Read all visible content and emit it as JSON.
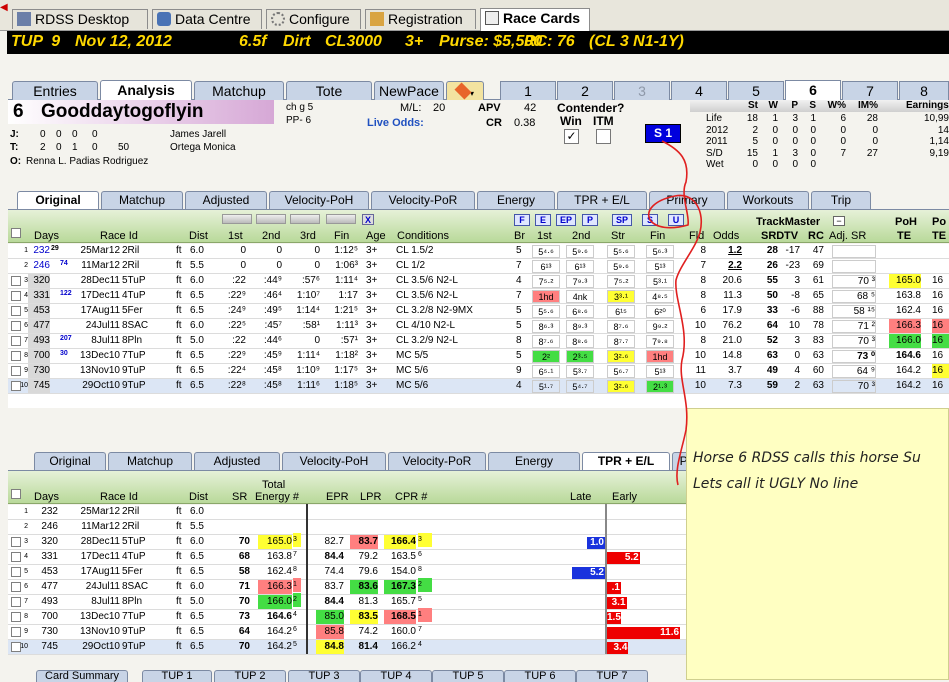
{
  "top_tabs": [
    "RDSS Desktop",
    "Data Centre",
    "Configure",
    "Registration",
    "Race Cards"
  ],
  "header": {
    "track": "TUP",
    "race": "9",
    "date": "Nov 12, 2012",
    "dist": "6.5f",
    "surface": "Dirt",
    "class": "CL3000",
    "age": "3+",
    "purse": "Purse: $5,500",
    "rc": "RC: 76",
    "cond": "(CL 3 N1-1Y)"
  },
  "sub_tabs": [
    "Entries",
    "Analysis",
    "Matchup",
    "Tote",
    "NewPace"
  ],
  "num_tabs": [
    "1",
    "2",
    "3",
    "4",
    "5",
    "6",
    "7",
    "8"
  ],
  "horse": {
    "num": "6",
    "name": "Gooddaytogoflyin",
    "sex": "ch g 5",
    "pp": "PP- 6",
    "ml_label": "M/L:",
    "ml": "20",
    "live_odds": "Live Odds:",
    "apv_label": "APV",
    "apv": "42",
    "cr_label": "CR",
    "cr": "0.38",
    "j_label": "J:",
    "j_stats": [
      "0",
      "0",
      "0",
      "0"
    ],
    "jockey": "James Jarell",
    "t_label": "T:",
    "t_stats": [
      "2",
      "0",
      "1",
      "0",
      "50"
    ],
    "trainer": "Ortega Monica",
    "o_label": "O:",
    "owner": "Renna L. Padias Rodriguez"
  },
  "contender": {
    "title": "Contender?",
    "win": "Win",
    "itm": "ITM",
    "check": "✓",
    "s1": "S 1"
  },
  "record": {
    "headers": [
      "St",
      "W",
      "P",
      "S",
      "W%",
      "IM%",
      "Earnings"
    ],
    "rows": [
      [
        "Life",
        "18",
        "1",
        "3",
        "1",
        "6",
        "28",
        "10,99"
      ],
      [
        "2012",
        "2",
        "0",
        "0",
        "0",
        "0",
        "0",
        "14"
      ],
      [
        "2011",
        "5",
        "0",
        "0",
        "0",
        "0",
        "0",
        "1,14"
      ],
      [
        "S/D",
        "15",
        "1",
        "3",
        "0",
        "7",
        "27",
        "9,19"
      ],
      [
        "Wet",
        "0",
        "0",
        "0",
        "0",
        "",
        "",
        ""
      ]
    ]
  },
  "row_tabs_top": [
    "Original",
    "Matchup",
    "Adjusted",
    "Velocity-PoH",
    "Velocity-PoR",
    "Energy",
    "TPR + E/L",
    "Primary",
    "Workouts",
    "Trip"
  ],
  "upper_grid": {
    "headers": {
      "days": "Days",
      "race_id": "Race Id",
      "dist": "Dist",
      "c1st": "1st",
      "c2nd": "2nd",
      "c3rd": "3rd",
      "fin": "Fin",
      "age": "Age",
      "conditions": "Conditions",
      "br": "Br",
      "b1st": "1st",
      "b2nd": "2nd",
      "str": "Str",
      "bfin": "Fin",
      "fld": "Fld",
      "odds": "Odds",
      "tm": "TrackMaster",
      "srd": "SRD",
      "tv": "TV",
      "rc": "RC",
      "adj": "Adj. SR",
      "poh": "PoH",
      "te": "TE",
      "po": "Po",
      "te2": "TE"
    },
    "btns": [
      "F",
      "E",
      "EP",
      "P",
      "SP",
      "S",
      "U"
    ],
    "x_btn": "X",
    "rows": [
      {
        "n": "1",
        "days": "232",
        "sup": "29",
        "dt": "25Mar12",
        "rid": "2Ril",
        "sf": "ft",
        "d": "6.0",
        "a": "0",
        "b": "0",
        "c": "0",
        "f": "1:12⁵",
        "age": "3+",
        "cond": "CL 1.5/2",
        "br": "5",
        "p1": "5⁴·⁶",
        "p2": "5⁹·⁶",
        "ps": "5⁵·⁶",
        "pf": "5⁶·³",
        "fld": "8",
        "odds": "1.2",
        "srd": "28",
        "tv": "-17",
        "rc": "47",
        "adj": "",
        "poh": "",
        "te": ""
      },
      {
        "n": "2",
        "days": "246",
        "sup": "74",
        "dt": "11Mar12",
        "rid": "2Ril",
        "sf": "ft",
        "d": "5.5",
        "a": "0",
        "b": "0",
        "c": "0",
        "f": "1:06³",
        "age": "3+",
        "cond": "CL 1/2",
        "br": "7",
        "p1": "6¹³",
        "p2": "6¹³",
        "ps": "5⁹·⁶",
        "pf": "5¹³",
        "fld": "7",
        "odds": "2.2",
        "srd": "26",
        "tv": "-23",
        "rc": "69",
        "adj": "",
        "poh": "",
        "te": ""
      },
      {
        "n": "3",
        "days": "320",
        "sup": "",
        "dt": "28Dec11",
        "rid": "5TuP",
        "sf": "ft",
        "d": "6.0",
        "a": ":22",
        "b": ":44⁹",
        "c": ":57⁶",
        "f": "1:11⁴",
        "age": "3+",
        "cond": "CL 3.5/6 N2-L",
        "br": "4",
        "p1": "7⁵·²",
        "p2": "7⁹·³",
        "ps": "7⁵·²",
        "pf": "5³·¹",
        "fld": "8",
        "odds": "20.6",
        "srd": "55",
        "tv": "3",
        "rc": "61",
        "adj": "70 ³",
        "poh": "165.0",
        "te": "16"
      },
      {
        "n": "4",
        "days": "331",
        "sup": "122",
        "dt": "17Dec11",
        "rid": "4TuP",
        "sf": "ft",
        "d": "6.5",
        "a": ":22⁹",
        "b": ":46⁴",
        "c": "1:10⁷",
        "f": "1:17",
        "age": "3+",
        "cond": "CL 3.5/6 N2-L",
        "br": "7",
        "p1": "1hd",
        "p2": "4nk",
        "ps": "3³·¹",
        "pf": "4⁸·⁵",
        "fld": "8",
        "odds": "11.3",
        "srd": "50",
        "tv": "-8",
        "rc": "65",
        "adj": "68 ⁵",
        "poh": "163.8",
        "te": "16"
      },
      {
        "n": "5",
        "days": "453",
        "sup": "",
        "dt": "17Aug11",
        "rid": "5Fer",
        "sf": "ft",
        "d": "6.5",
        "a": ":24⁹",
        "b": ":49⁵",
        "c": "1:14⁴",
        "f": "1:21⁵",
        "age": "3+",
        "cond": "CL 3.2/8 N2-9MX",
        "br": "5",
        "p1": "5⁵·⁶",
        "p2": "6⁸·⁶",
        "ps": "6¹⁵",
        "pf": "6²⁰",
        "fld": "6",
        "odds": "17.9",
        "srd": "33",
        "tv": "-6",
        "rc": "88",
        "adj": "58 ¹⁵",
        "poh": "162.4",
        "te": "16"
      },
      {
        "n": "6",
        "days": "477",
        "sup": "",
        "dt": "24Jul11",
        "rid": "8SAC",
        "sf": "ft",
        "d": "6.0",
        "a": ":22⁵",
        "b": ":45⁷",
        "c": ":58¹",
        "f": "1:11³",
        "age": "3+",
        "cond": "CL 4/10 N2-L",
        "br": "5",
        "p1": "8⁶·³",
        "p2": "8⁹·³",
        "ps": "8⁷·⁶",
        "pf": "9⁹·²",
        "fld": "10",
        "odds": "76.2",
        "srd": "64",
        "tv": "10",
        "rc": "78",
        "adj": "71 ²",
        "poh": "166.3",
        "te": "16"
      },
      {
        "n": "7",
        "days": "493",
        "sup": "207",
        "dt": "8Jul11",
        "rid": "8Pln",
        "sf": "ft",
        "d": "5.0",
        "a": ":22",
        "b": ":44⁶",
        "c": "0",
        "f": ":57¹",
        "age": "3+",
        "cond": "CL 3.2/9 N2-L",
        "br": "8",
        "p1": "8⁷·⁶",
        "p2": "8⁸·⁶",
        "ps": "8⁷·⁷",
        "pf": "7⁹·⁸",
        "fld": "8",
        "odds": "21.0",
        "srd": "52",
        "tv": "3",
        "rc": "83",
        "adj": "70 ³",
        "poh": "166.0",
        "te": "16"
      },
      {
        "n": "8",
        "days": "700",
        "sup": "30",
        "dt": "13Dec10",
        "rid": "7TuP",
        "sf": "ft",
        "d": "6.5",
        "a": ":22⁹",
        "b": ":45⁹",
        "c": "1:11⁴",
        "f": "1:18²",
        "age": "3+",
        "cond": "MC 5/5",
        "br": "5",
        "p1": "2²",
        "p2": "2³·⁵",
        "ps": "3²·⁶",
        "pf": "1hd",
        "fld": "10",
        "odds": "14.8",
        "srd": "63",
        "tv": "0",
        "rc": "63",
        "adj": "73 ⁰",
        "poh": "164.6",
        "te": "16"
      },
      {
        "n": "9",
        "days": "730",
        "sup": "",
        "dt": "13Nov10",
        "rid": "9TuP",
        "sf": "ft",
        "d": "6.5",
        "a": ":22⁴",
        "b": ":45⁸",
        "c": "1:10⁹",
        "f": "1:17⁵",
        "age": "3+",
        "cond": "MC 5/6",
        "br": "9",
        "p1": "6⁵·¹",
        "p2": "5³·⁷",
        "ps": "5⁶·⁷",
        "pf": "5¹³",
        "fld": "11",
        "odds": "3.7",
        "srd": "49",
        "tv": "4",
        "rc": "60",
        "adj": "64 ⁹",
        "poh": "164.2",
        "te": "16"
      },
      {
        "n": "10",
        "days": "745",
        "sup": "",
        "dt": "29Oct10",
        "rid": "9TuP",
        "sf": "ft",
        "d": "6.5",
        "a": ":22⁸",
        "b": ":45⁸",
        "c": "1:11⁶",
        "f": "1:18⁵",
        "age": "3+",
        "cond": "MC 5/6",
        "br": "4",
        "p1": "5¹·⁷",
        "p2": "5⁴·⁷",
        "ps": "3²·⁶",
        "pf": "2¹·³",
        "fld": "10",
        "odds": "7.3",
        "srd": "59",
        "tv": "2",
        "rc": "63",
        "adj": "70 ³",
        "poh": "164.2",
        "te": "16"
      }
    ]
  },
  "row_tabs_bottom": [
    "Original",
    "Matchup",
    "Adjusted",
    "Velocity-PoH",
    "Velocity-PoR",
    "Energy",
    "TPR + E/L",
    "Pri"
  ],
  "lower_grid": {
    "headers": {
      "days": "Days",
      "race_id": "Race Id",
      "dist": "Dist",
      "sr": "SR",
      "total": "Total",
      "energy": "Energy #",
      "epr": "EPR",
      "lpr": "LPR",
      "cpr": "CPR #",
      "late": "Late",
      "early": "Early"
    },
    "rows": [
      {
        "n": "1",
        "days": "232",
        "dt": "25Mar12",
        "rid": "2Ril",
        "sf": "ft",
        "d": "6.0",
        "sr": "",
        "en": "",
        "enr": "",
        "epr": "",
        "lpr": "",
        "cpr": "",
        "cr": ""
      },
      {
        "n": "2",
        "days": "246",
        "dt": "11Mar12",
        "rid": "2Ril",
        "sf": "ft",
        "d": "5.5",
        "sr": "",
        "en": "",
        "enr": "",
        "epr": "",
        "lpr": "",
        "cpr": "",
        "cr": ""
      },
      {
        "n": "3",
        "days": "320",
        "dt": "28Dec11",
        "rid": "5TuP",
        "sf": "ft",
        "d": "6.0",
        "sr": "70",
        "en": "165.0",
        "enr": "3",
        "epr": "82.7",
        "lpr": "83.7",
        "cpr": "166.4",
        "cr": "3"
      },
      {
        "n": "4",
        "days": "331",
        "dt": "17Dec11",
        "rid": "4TuP",
        "sf": "ft",
        "d": "6.5",
        "sr": "68",
        "en": "163.8",
        "enr": "7",
        "epr": "84.4",
        "lpr": "79.2",
        "cpr": "163.5",
        "cr": "6"
      },
      {
        "n": "5",
        "days": "453",
        "dt": "17Aug11",
        "rid": "5Fer",
        "sf": "ft",
        "d": "6.5",
        "sr": "58",
        "en": "162.4",
        "enr": "8",
        "epr": "74.4",
        "lpr": "79.6",
        "cpr": "154.0",
        "cr": "8"
      },
      {
        "n": "6",
        "days": "477",
        "dt": "24Jul11",
        "rid": "8SAC",
        "sf": "ft",
        "d": "6.0",
        "sr": "71",
        "en": "166.3",
        "enr": "1",
        "epr": "83.7",
        "lpr": "83.6",
        "cpr": "167.3",
        "cr": "2"
      },
      {
        "n": "7",
        "days": "493",
        "dt": "8Jul11",
        "rid": "8Pln",
        "sf": "ft",
        "d": "5.0",
        "sr": "70",
        "en": "166.0",
        "enr": "2",
        "epr": "84.4",
        "lpr": "81.3",
        "cpr": "165.7",
        "cr": "5"
      },
      {
        "n": "8",
        "days": "700",
        "dt": "13Dec10",
        "rid": "7TuP",
        "sf": "ft",
        "d": "6.5",
        "sr": "73",
        "en": "164.6",
        "enr": "4",
        "epr": "85.0",
        "lpr": "83.5",
        "cpr": "168.5",
        "cr": "1"
      },
      {
        "n": "9",
        "days": "730",
        "dt": "13Nov10",
        "rid": "9TuP",
        "sf": "ft",
        "d": "6.5",
        "sr": "64",
        "en": "164.2",
        "enr": "6",
        "epr": "85.8",
        "lpr": "74.2",
        "cpr": "160.0",
        "cr": "7"
      },
      {
        "n": "10",
        "days": "745",
        "dt": "29Oct10",
        "rid": "9TuP",
        "sf": "ft",
        "d": "6.5",
        "sr": "70",
        "en": "164.2",
        "enr": "5",
        "epr": "84.8",
        "lpr": "81.4",
        "cpr": "166.2",
        "cr": "4"
      }
    ],
    "late_vals": [
      {
        "row": 3,
        "v": "1.0"
      },
      {
        "row": 5,
        "v": "5.2"
      }
    ],
    "early_vals": [
      {
        "row": 4,
        "v": "5.2"
      },
      {
        "row": 6,
        "v": ".1"
      },
      {
        "row": 7,
        "v": "3.1"
      },
      {
        "row": 8,
        "v": "1.5"
      },
      {
        "row": 9,
        "v": "11.6"
      },
      {
        "row": 10,
        "v": "3.4"
      }
    ]
  },
  "bottom_tabs": [
    "Card Summary",
    "TUP 1",
    "TUP 2",
    "TUP 3",
    "TUP 4",
    "TUP 5",
    "TUP 6",
    "TUP 7"
  ],
  "note": {
    "line1": "Horse 6  RDSS calls this horse Su",
    "line2": "Lets call it UGLY No line"
  },
  "colors": {
    "yellow": "#ffff33",
    "red": "#ff7f7f",
    "green": "#44dd44",
    "blue": "#0000dd",
    "bar_red": "#ee0000",
    "bar_blue": "#1a33dd"
  }
}
